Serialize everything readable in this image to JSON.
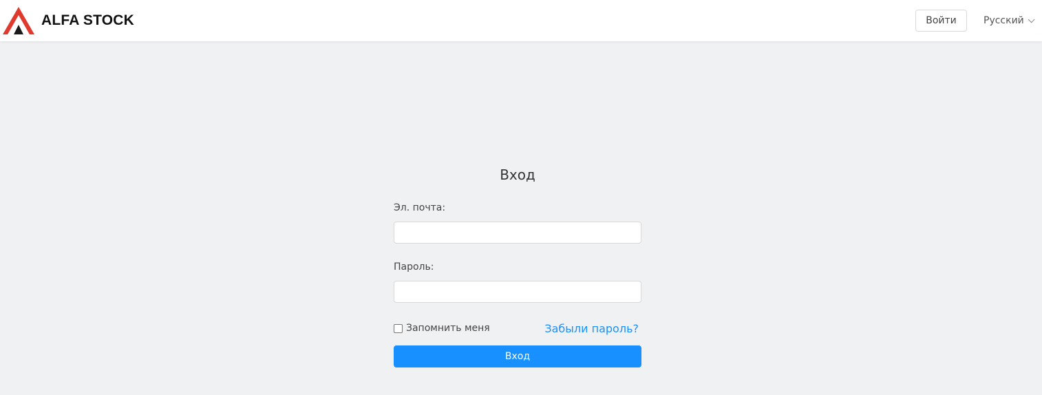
{
  "header": {
    "logo_text": "ALFA STOCK",
    "login_label": "Войти",
    "language": "Русский"
  },
  "form": {
    "title": "Вход",
    "email_label": "Эл. почта:",
    "email_value": "",
    "password_label": "Пароль:",
    "password_value": "",
    "remember_label": "Запомнить меня",
    "remember_checked": false,
    "forgot_label": "Забыли пароль?",
    "submit_label": "Вход"
  },
  "colors": {
    "accent": "#1890ff",
    "logo_red": "#e03a2f",
    "logo_dark": "#1a1a1a",
    "background": "#f0f1f3"
  },
  "icons": {
    "logo": "alfa-triangle-logo-icon",
    "dropdown": "chevron-down-icon"
  }
}
